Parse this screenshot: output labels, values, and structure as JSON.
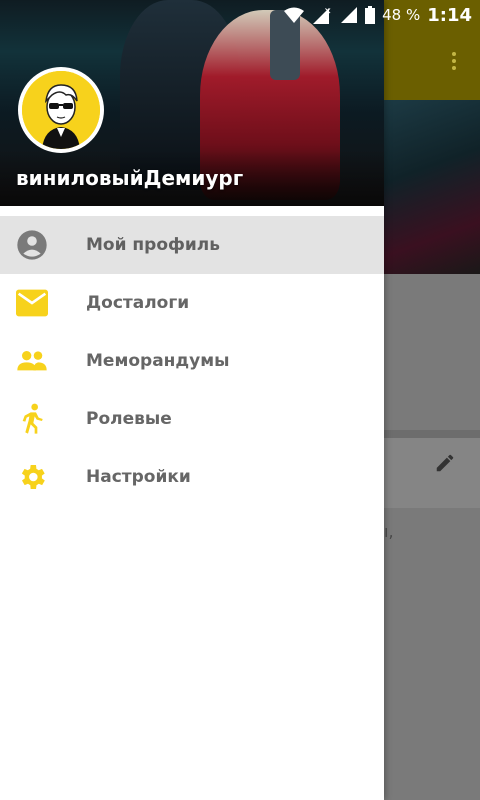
{
  "status_bar": {
    "battery_percent": "48 %",
    "time": "1:14"
  },
  "drawer": {
    "username": "виниловыйДемиург",
    "menu": [
      {
        "label": "Мой профиль",
        "icon": "account-circle-icon",
        "active": true
      },
      {
        "label": "Досталоги",
        "icon": "mail-icon",
        "active": false
      },
      {
        "label": "Меморандумы",
        "icon": "people-icon",
        "active": false
      },
      {
        "label": "Ролевые",
        "icon": "running-person-icon",
        "active": false
      },
      {
        "label": "Настройки",
        "icon": "gear-icon",
        "active": false
      }
    ]
  },
  "colors": {
    "accent": "#f7d21c",
    "active_item_bg": "#e3e3e3",
    "scrim": "#777777"
  }
}
